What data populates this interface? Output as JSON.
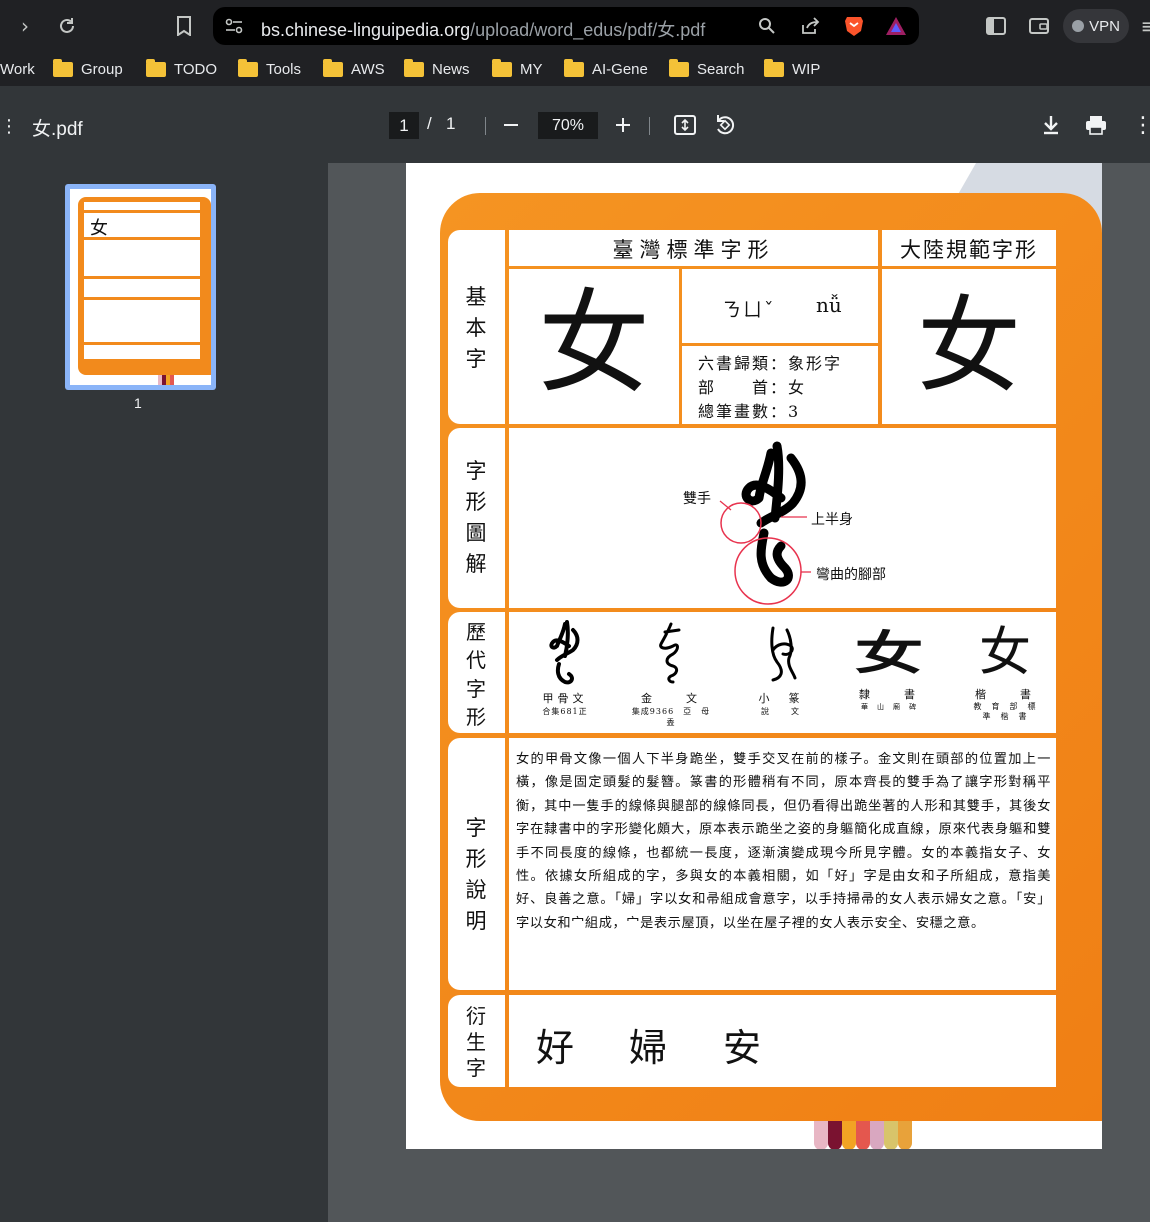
{
  "browser": {
    "url_host": "bs.chinese-linguipedia.org",
    "url_path": "/upload/word_edus/pdf/女.pdf",
    "vpn_label": "VPN"
  },
  "bookmarks": [
    "Work",
    "Group",
    "TODO",
    "Tools",
    "AWS",
    "News",
    "MY",
    "AI-Gene",
    "Search",
    "WIP"
  ],
  "pdf": {
    "title": "女.pdf",
    "page_current": "1",
    "page_sep": "/",
    "page_total": "1",
    "zoom": "70%",
    "thumb_label": "1"
  },
  "doc": {
    "hdr_tw": "臺灣標準字形",
    "hdr_cn": "大陸規範字形",
    "label_basic": "基本字",
    "label_diagram": "字形圖解",
    "label_history": "歷代字形",
    "label_explain": "字形說明",
    "label_derived": "衍生字",
    "main_char": "女",
    "bopomofo": "ㄋㄩˇ",
    "pinyin": "nǚ",
    "liushu": "六書歸類：象形字",
    "radical": "部　　首：女",
    "strokes": "總筆畫數：3",
    "anno_hands": "雙手",
    "anno_upper": "上半身",
    "anno_legs": "彎曲的腳部",
    "history": [
      {
        "name": "甲骨文",
        "src": "合集681正",
        "glyph": "女"
      },
      {
        "name": "金　　文",
        "src": "集成9366　亞　母　盉",
        "glyph": "女"
      },
      {
        "name": "小　篆",
        "src": "說　　文",
        "glyph": "女"
      },
      {
        "name": "隸　　書",
        "src": "華　山　廟　碑",
        "glyph": "女"
      },
      {
        "name": "楷　　書",
        "src": "教　育　部　標　準　楷　書",
        "glyph": "女"
      }
    ],
    "explanation": "女的甲骨文像一個人下半身跪坐，雙手交叉在前的樣子。金文則在頭部的位置加上一橫，像是固定頭髮的髮簪。篆書的形體稍有不同，原本齊長的雙手為了讓字形對稱平衡，其中一隻手的線條與腿部的線條同長，但仍看得出跪坐著的人形和其雙手，其後女字在隸書中的字形變化頗大，原本表示跪坐之姿的身軀簡化成直線，原來代表身軀和雙手不同長度的線條，也都統一長度，逐漸演變成現今所見字體。女的本義指女子、女性。依據女所組成的字，多與女的本義相關，如「好」字是由女和子所組成，意指美好、良善之意。「婦」字以女和帚組成會意字，以手持掃帚的女人表示婦女之意。「安」字以女和宀組成，宀是表示屋頂，以坐在屋子裡的女人表示安全、安穩之意。",
    "derived": [
      "好",
      "婦",
      "安"
    ],
    "card_color": "#f28a1c"
  }
}
